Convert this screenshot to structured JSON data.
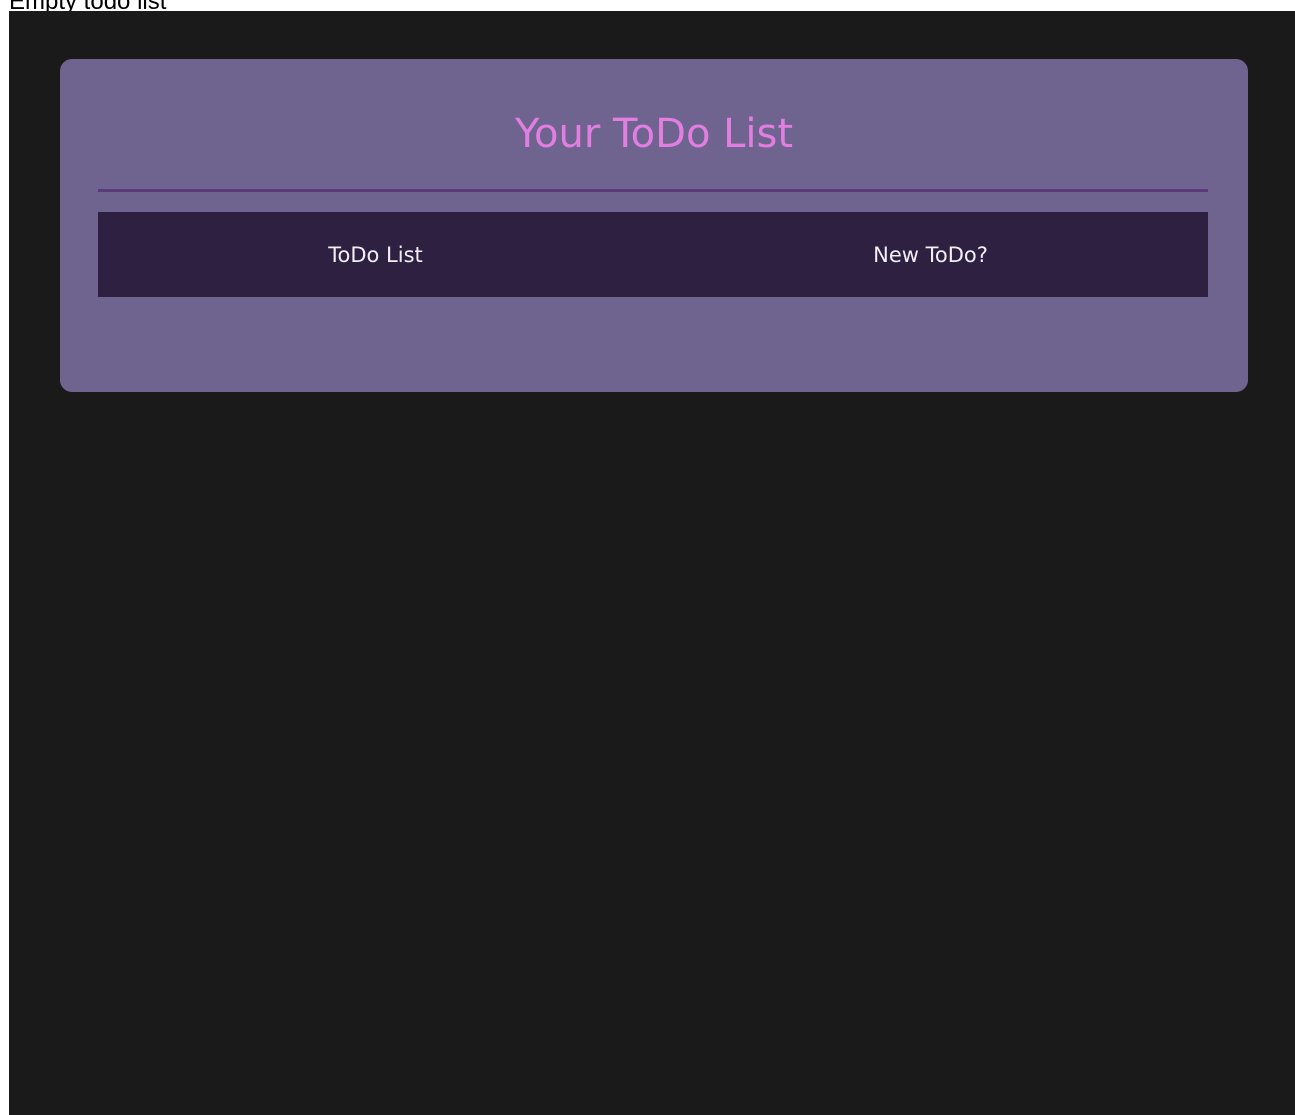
{
  "caption": "Empty todo list",
  "card": {
    "title": "Your ToDo List"
  },
  "nav": {
    "items": [
      {
        "label": "ToDo List"
      },
      {
        "label": "New ToDo?"
      }
    ]
  },
  "colors": {
    "page_background": "#1a1a1a",
    "card_background": "#6f6390",
    "title_color": "#e17ee0",
    "divider_color": "#5a3a78",
    "nav_background": "#2e2040",
    "nav_text": "#f2eef5"
  }
}
